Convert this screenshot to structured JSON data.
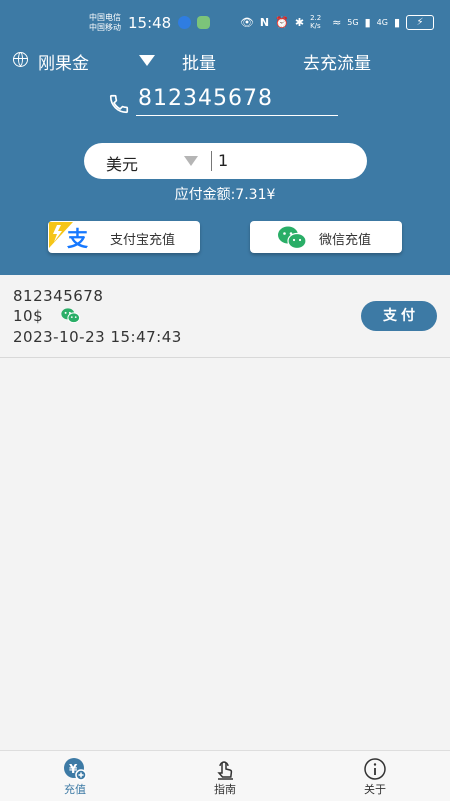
{
  "status_bar": {
    "carrier_1": "中国电信",
    "carrier_2": "中国移动",
    "time": "15:48",
    "speed": "2.2 K/s",
    "net_1": "5G",
    "net_2": "4G"
  },
  "top_bar": {
    "region": "刚果金",
    "batch": "批量",
    "flow": "去充流量"
  },
  "phone": {
    "number": "812345678"
  },
  "amount": {
    "currency": "美元",
    "quantity": "1",
    "payable": "应付金额:7.31¥"
  },
  "pay_buttons": {
    "alipay": "支付宝充值",
    "wechat": "微信充值"
  },
  "records": [
    {
      "number": "812345678",
      "amount": "10$",
      "time": "2023-10-23 15:47:43",
      "action": "支付"
    }
  ],
  "nav": [
    {
      "label": "充值",
      "icon": "recharge-icon",
      "active": true
    },
    {
      "label": "指南",
      "icon": "guide-icon",
      "active": false
    },
    {
      "label": "关于",
      "icon": "info-icon",
      "active": false
    }
  ],
  "colors": {
    "primary": "#3d7aa5",
    "wechat_green": "#2aae67",
    "alipay_blue": "#1678ff",
    "bolt_yellow": "#f5c518"
  }
}
